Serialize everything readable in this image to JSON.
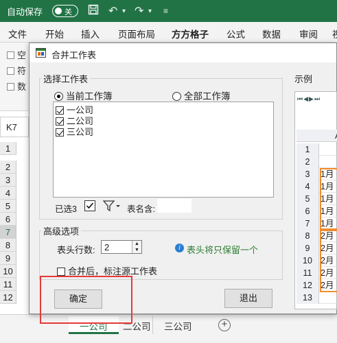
{
  "titlebar": {
    "autosave_label": "自动保存",
    "toggle_state": "关"
  },
  "ribbon": {
    "tabs": [
      "文件",
      "开始",
      "插入",
      "页面布局",
      "方方格子",
      "公式",
      "数据",
      "审阅",
      "视"
    ],
    "active_tab": "方方格子"
  },
  "ribbon_body": {
    "items": [
      "空",
      "符",
      "数"
    ]
  },
  "namebox": "K7",
  "row_headers": [
    "1",
    "2",
    "3",
    "4",
    "5",
    "6",
    "7",
    "8",
    "9",
    "10",
    "11",
    "12"
  ],
  "sheets": [
    "一公司",
    "二公司",
    "三公司"
  ],
  "dialog": {
    "title": "合并工作表",
    "select_group_label": "选择工作表",
    "radio_current": "当前工作簿",
    "radio_all": "全部工作簿",
    "sheet_list": [
      "一公司",
      "二公司",
      "三公司"
    ],
    "selected_count": "已选3",
    "sheet_name_label": "表名含:",
    "sheet_name_value": "",
    "advanced_label": "高级选项",
    "header_rows_label": "表头行数:",
    "header_rows_value": "2",
    "hint": "表头将只保留一个",
    "mark_source_label": "合并后，标注源工作表",
    "ok_button": "确定",
    "exit_button": "退出",
    "preview_label": "示例",
    "preview_col": "A",
    "preview_rows": [
      {
        "num": "1",
        "val": ""
      },
      {
        "num": "2",
        "val": ""
      },
      {
        "num": "3",
        "val": "1月"
      },
      {
        "num": "4",
        "val": "1月"
      },
      {
        "num": "5",
        "val": "1月"
      },
      {
        "num": "6",
        "val": "1月"
      },
      {
        "num": "7",
        "val": "1月"
      },
      {
        "num": "8",
        "val": "2月"
      },
      {
        "num": "9",
        "val": "2月"
      },
      {
        "num": "10",
        "val": "2月"
      },
      {
        "num": "11",
        "val": "2月"
      },
      {
        "num": "12",
        "val": "2月"
      },
      {
        "num": "13",
        "val": ""
      }
    ]
  },
  "colors": {
    "excel_green": "#217346",
    "highlight_orange": "#f08c2b",
    "annotation_red": "#e53935"
  }
}
